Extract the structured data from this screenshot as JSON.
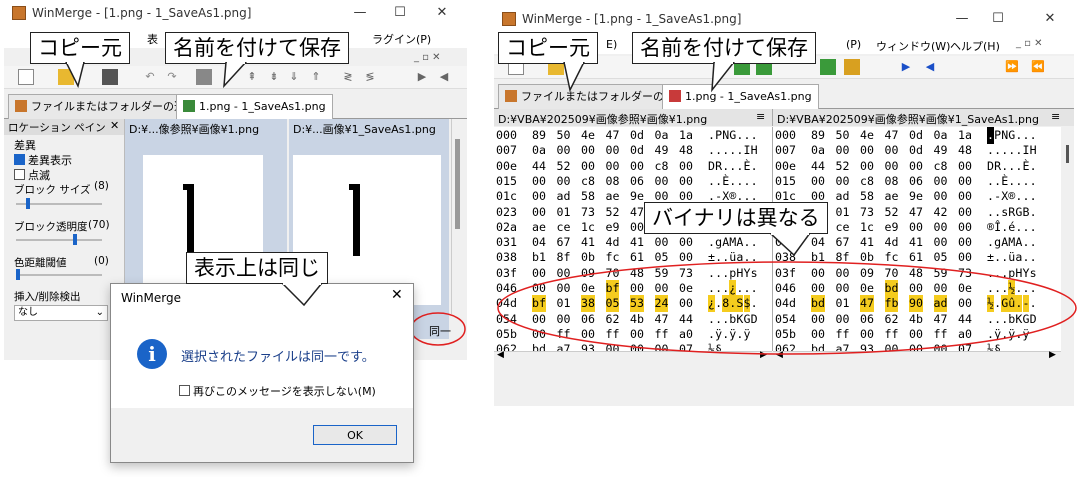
{
  "left": {
    "window_title": "WinMerge - [1.png - 1_SaveAs1.png]",
    "menu_fragments": [
      "表",
      "ラグイン(P)"
    ],
    "tab_files": "ファイルまたはフォルダーの選択",
    "tab_compare": "1.png - 1_SaveAs1.png",
    "pane_header_left": "D:¥...像参照¥画像¥1.png",
    "pane_header_right": "D:¥...画像¥1_SaveAs1.png",
    "location_pane": {
      "title": "ロケーション ペイン",
      "section": "差異",
      "show_diff_label": "差異表示",
      "blink_label": "点滅",
      "block_size_label": "ブロック サイズ",
      "block_size_value": "(8)",
      "block_size_level": 0.12,
      "block_alpha_label": "ブロック透明度",
      "block_alpha_value": "(70)",
      "block_alpha_level": 0.7,
      "color_threshold_label": "色距離閾値",
      "color_threshold_value": "(0)",
      "color_threshold_level": 0.0,
      "insert_delete_label": "挿入/削除検出",
      "insert_delete_value": "なし"
    },
    "status_same": "同一",
    "dialog": {
      "title": "WinMerge",
      "message": "選択されたファイルは同一です。",
      "checkbox": "再びこのメッセージを表示しない(M)",
      "ok": "OK"
    }
  },
  "right": {
    "window_title": "WinMerge - [1.png - 1_SaveAs1.png]",
    "menu_items": [
      "E)",
      "(P)",
      "ウィンドウ(W)",
      "ヘルプ(H)"
    ],
    "tab_files": "ファイルまたはフォルダーの選択",
    "tab_compare": "1.png - 1_SaveAs1.png",
    "path_left": "D:¥VBA¥202509¥画像参照¥画像¥1.png",
    "path_right": "D:¥VBA¥202509¥画像参照¥画像¥1_SaveAs1.png",
    "hex_left": [
      {
        "addr": "000",
        "bytes": "89 50 4e 47 0d 0a 1a",
        "ascii": ".PNG..."
      },
      {
        "addr": "007",
        "bytes": "0a 00 00 00 0d 49 48",
        "ascii": ".....IH"
      },
      {
        "addr": "00e",
        "bytes": "44 52 00 00 00 c8 00",
        "ascii": "DR...È."
      },
      {
        "addr": "015",
        "bytes": "00 00 c8 08 06 00 00",
        "ascii": "..È...."
      },
      {
        "addr": "01c",
        "bytes": "00 ad 58 ae 9e 00 00",
        "ascii": ".-X®..."
      },
      {
        "addr": "023",
        "bytes": "00 01 73 52 47 42 00",
        "ascii": "..sRGB."
      },
      {
        "addr": "02a",
        "bytes": "ae ce 1c e9 00 00 00",
        "ascii": "®Î.é..."
      },
      {
        "addr": "031",
        "bytes": "04 67 41 4d 41 00 00",
        "ascii": ".gAMA.."
      },
      {
        "addr": "038",
        "bytes": "b1 8f 0b fc 61 05 00",
        "ascii": "±..üa.."
      },
      {
        "addr": "03f",
        "bytes": "00 00 09 70 48 59 73",
        "ascii": "...pHYs"
      },
      {
        "addr": "046",
        "bytes": "00 00 0e bf 00 00 0e",
        "ascii": "...¿..."
      },
      {
        "addr": "04d",
        "bytes": "bf 01 38 05 53 24 00",
        "ascii": "¿.8.S$."
      },
      {
        "addr": "054",
        "bytes": "00 00 06 62 4b 47 44",
        "ascii": "...bKGD"
      },
      {
        "addr": "05b",
        "bytes": "00 ff 00 ff 00 ff a0",
        "ascii": ".ÿ.ÿ.ÿ "
      },
      {
        "addr": "062",
        "bytes": "bd a7 93 00 00 00 07",
        "ascii": "½§....."
      }
    ],
    "hex_right": [
      {
        "addr": "000",
        "bytes": "89 50 4e 47 0d 0a 1a",
        "ascii": ".PNG..."
      },
      {
        "addr": "007",
        "bytes": "0a 00 00 00 0d 49 48",
        "ascii": ".....IH"
      },
      {
        "addr": "00e",
        "bytes": "44 52 00 00 00 c8 00",
        "ascii": "DR...È."
      },
      {
        "addr": "015",
        "bytes": "00 00 c8 08 06 00 00",
        "ascii": "..È...."
      },
      {
        "addr": "01c",
        "bytes": "00 ad 58 ae 9e 00 00",
        "ascii": ".-X®..."
      },
      {
        "addr": "023",
        "bytes": "00 01 73 52 47 42 00",
        "ascii": "..sRGB."
      },
      {
        "addr": "02a",
        "bytes": "ae ce 1c e9 00 00 00",
        "ascii": "®Î.é..."
      },
      {
        "addr": "031",
        "bytes": "04 67 41 4d 41 00 00",
        "ascii": ".gAMA.."
      },
      {
        "addr": "038",
        "bytes": "b1 8f 0b fc 61 05 00",
        "ascii": "±..üa.."
      },
      {
        "addr": "03f",
        "bytes": "00 00 09 70 48 59 73",
        "ascii": "...pHYs"
      },
      {
        "addr": "046",
        "bytes": "00 00 0e bd 00 00 0e",
        "ascii": "...½..."
      },
      {
        "addr": "04d",
        "bytes": "bd 01 47 fb 90 ad 00",
        "ascii": "½.Gû.-."
      },
      {
        "addr": "054",
        "bytes": "00 00 06 62 4b 47 44",
        "ascii": "...bKGD"
      },
      {
        "addr": "05b",
        "bytes": "00 ff 00 ff 00 ff a0",
        "ascii": ".ÿ.ÿ.ÿ "
      },
      {
        "addr": "062",
        "bytes": "bd a7 93 00 00 00 07",
        "ascii": "½§....."
      }
    ]
  },
  "callouts": {
    "copy_source": "コピー元",
    "save_as": "名前を付けて保存",
    "display_same": "表示上は同じ",
    "binary_differs": "バイナリは異なる"
  },
  "colors": {
    "highlight": "#f5cc1e",
    "ellipse": "#e02020",
    "accent_blue": "#1a64c8",
    "pane_bg": "#c9d4e4"
  }
}
